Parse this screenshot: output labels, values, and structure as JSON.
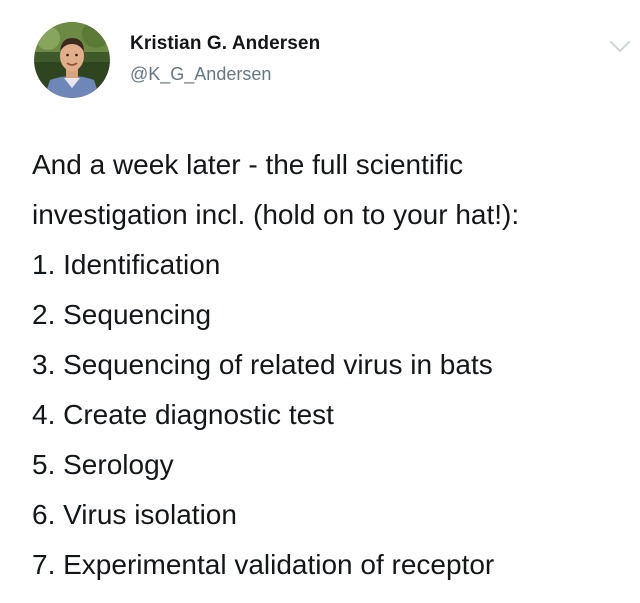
{
  "author": {
    "name": "Kristian G. Andersen",
    "handle": "@K_G_Andersen"
  },
  "icons": {
    "avatar": "profile-photo",
    "menu": "chevron-down-icon"
  },
  "colors": {
    "text": "#14171a",
    "handle": "#657786",
    "chevron": "#ccd6dd"
  },
  "tweet": {
    "lines": [
      "And a week later - the full scientific",
      "investigation incl. (hold on to your hat!):",
      "1. Identification",
      "2. Sequencing",
      "3. Sequencing of related virus in bats",
      "4. Create diagnostic test",
      "5. Serology",
      "6. Virus isolation",
      "7. Experimental validation of receptor"
    ]
  }
}
